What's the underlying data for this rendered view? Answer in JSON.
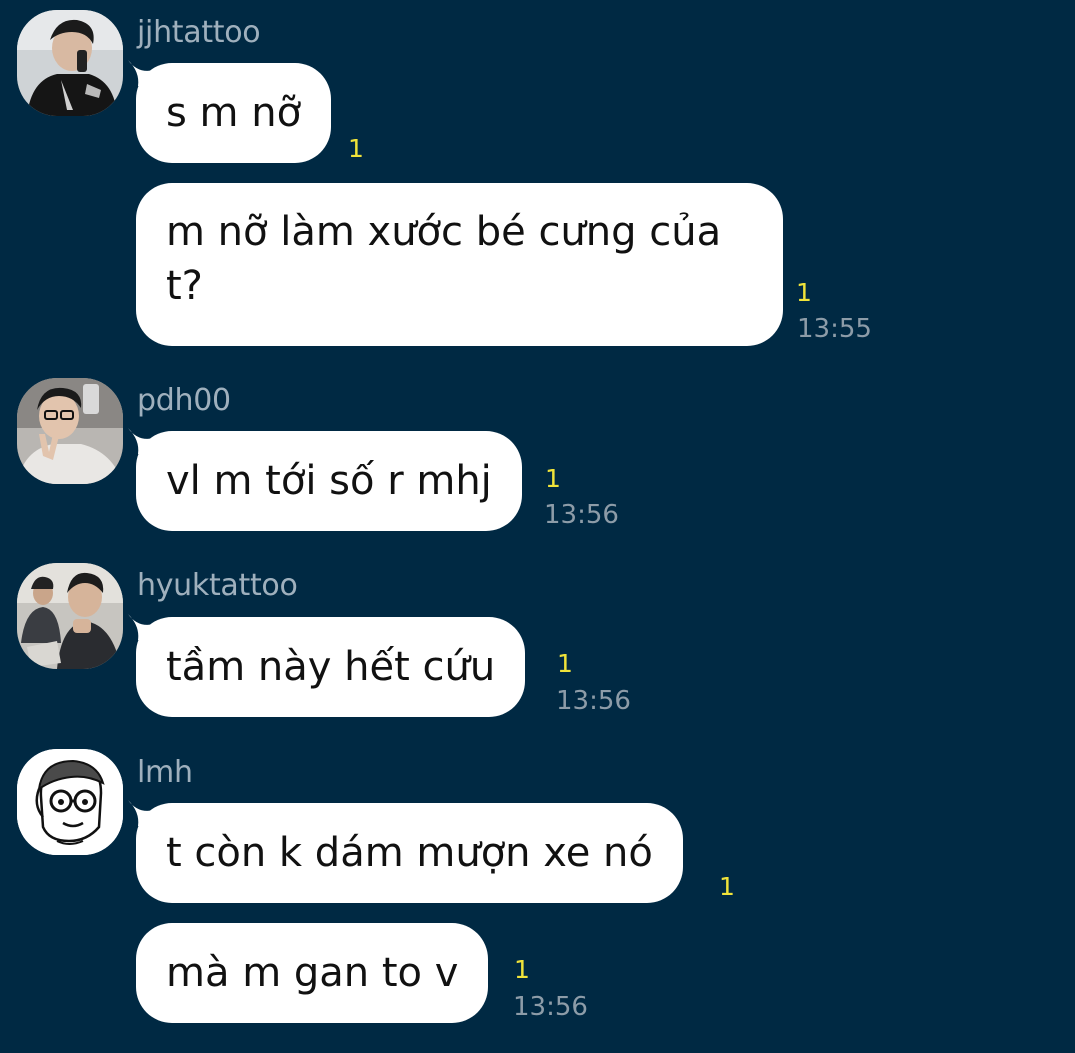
{
  "colors": {
    "background": "#002943",
    "bubble": "#ffffff",
    "sender": "#9fb0bd",
    "unread": "#f0e33a",
    "time": "#8d9ca8"
  },
  "messages": [
    {
      "sender": "jjhtattoo",
      "avatar_icon": "avatar-jjhtattoo-photo",
      "text": "s m nỡ",
      "unread": "1",
      "time": ""
    },
    {
      "sender": "",
      "text": "m nỡ làm xước bé cưng của t?",
      "unread": "1",
      "time": "13:55"
    },
    {
      "sender": "pdh00",
      "avatar_icon": "avatar-pdh00-photo",
      "text": "vl m tới số r mhj",
      "unread": "1",
      "time": "13:56"
    },
    {
      "sender": "hyuktattoo",
      "avatar_icon": "avatar-hyuktattoo-photo",
      "text": "tầm này hết cứu",
      "unread": "1",
      "time": "13:56"
    },
    {
      "sender": "lmh",
      "avatar_icon": "avatar-lmh-cartoon",
      "text": "t còn k dám mượn xe nó",
      "unread": "1",
      "time": ""
    },
    {
      "sender": "",
      "text": "mà m gan to v",
      "unread": "1",
      "time": "13:56"
    }
  ]
}
